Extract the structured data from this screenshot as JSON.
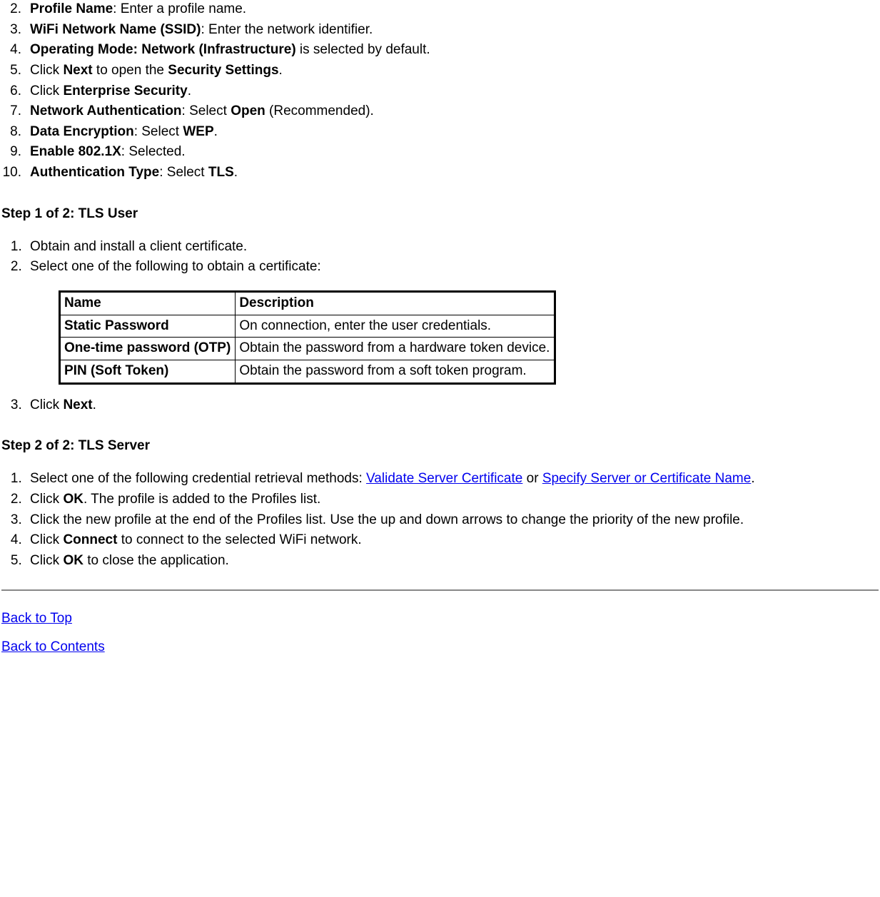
{
  "list_top": [
    {
      "bold1": "Profile Name",
      "after1": ": Enter a profile name."
    },
    {
      "bold1": "WiFi Network Name (SSID)",
      "after1": ": Enter the network identifier."
    },
    {
      "bold1": "Operating Mode: Network (Infrastructure)",
      "after1": " is selected by default."
    },
    {
      "pre": "Click ",
      "bold1": "Next",
      "mid": " to open the ",
      "bold2": "Security Settings",
      "after2": "."
    },
    {
      "pre": "Click ",
      "bold1": "Enterprise Security",
      "after1": "."
    },
    {
      "bold1": "Network Authentication",
      "mid": ": Select ",
      "bold2": "Open",
      "after2": " (Recommended)."
    },
    {
      "bold1": "Data Encryption",
      "mid": ": Select ",
      "bold2": "WEP",
      "after2": "."
    },
    {
      "bold1": "Enable 802.1X",
      "after1": ": Selected."
    },
    {
      "bold1": "Authentication Type",
      "mid": ": Select ",
      "bold2": "TLS",
      "after2": "."
    }
  ],
  "step1_heading": "Step 1 of 2: TLS User",
  "step1_list": {
    "item1": "Obtain and install a client certificate.",
    "item2": "Select one of the following to obtain a certificate:",
    "item3_pre": "Click ",
    "item3_bold": "Next",
    "item3_after": "."
  },
  "cert_table": {
    "headers": {
      "name": "Name",
      "desc": "Description"
    },
    "rows": [
      {
        "name": "Static Password",
        "desc": "On connection, enter the user credentials."
      },
      {
        "name": "One-time password (OTP)",
        "desc": "Obtain the password from a hardware token device."
      },
      {
        "name": "PIN (Soft Token)",
        "desc": "Obtain the password from a soft token program."
      }
    ]
  },
  "step2_heading": "Step 2 of 2: TLS Server",
  "step2_list": {
    "item1_pre": "Select one of the following credential retrieval methods: ",
    "item1_link1": "Validate Server Certificate",
    "item1_mid": " or ",
    "item1_link2": "Specify Server or Certificate Name",
    "item1_after": ".",
    "item2_pre": "Click ",
    "item2_bold": "OK",
    "item2_after": ". The profile is added to the Profiles list.",
    "item3": "Click the new profile at the end of the Profiles list. Use the up and down arrows to change the priority of the new profile.",
    "item4_pre": "Click ",
    "item4_bold": "Connect",
    "item4_after": " to connect to the selected WiFi network.",
    "item5_pre": "Click ",
    "item5_bold": "OK",
    "item5_after": " to close the application."
  },
  "end_links": {
    "back_top": "Back to Top",
    "back_contents": "Back to Contents"
  }
}
